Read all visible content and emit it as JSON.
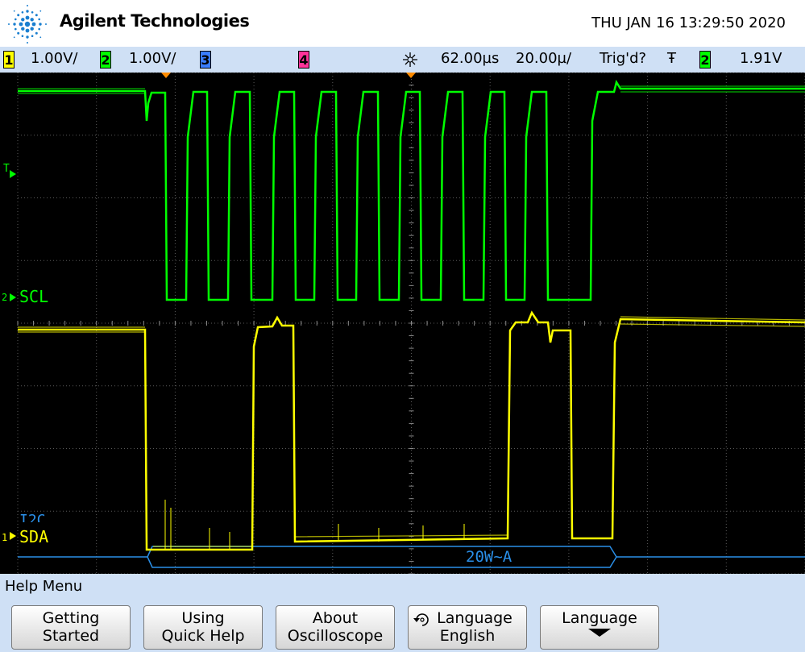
{
  "header": {
    "brand": "Agilent Technologies",
    "datetime": "THU JAN 16 13:29:50 2020"
  },
  "status": {
    "ch1": {
      "num": "1",
      "scale": "1.00V/",
      "color": "#ffff00"
    },
    "ch2": {
      "num": "2",
      "scale": "1.00V/",
      "color": "#00ff00"
    },
    "ch3": {
      "num": "3",
      "color": "#3a7dff"
    },
    "ch4": {
      "num": "4",
      "color": "#ff3399"
    },
    "delay": "62.00µs",
    "timebase": "20.00µ/",
    "trigger_status": "Trig'd?",
    "trigger_slope": "Ŧ",
    "trigger_source": "2",
    "trigger_level": "1.91V"
  },
  "screen": {
    "trig_marker": "T",
    "scl_label": "SCL",
    "sda_label": "SDA",
    "i2c_label": "I2C",
    "decode_text": "20W~A",
    "colors": {
      "scl": "#00ff00",
      "sda": "#ffff00",
      "bus": "#2a8fe8",
      "grid": "#5a5a5a"
    }
  },
  "menu": {
    "title": "Help Menu",
    "keys": [
      {
        "line1": "Getting",
        "line2": "Started"
      },
      {
        "line1": "Using",
        "line2": "Quick Help"
      },
      {
        "line1": "About",
        "line2": "Oscilloscope"
      },
      {
        "line1": "Language",
        "line2": "English"
      },
      {
        "line1": "Language",
        "line2": ""
      }
    ]
  }
}
